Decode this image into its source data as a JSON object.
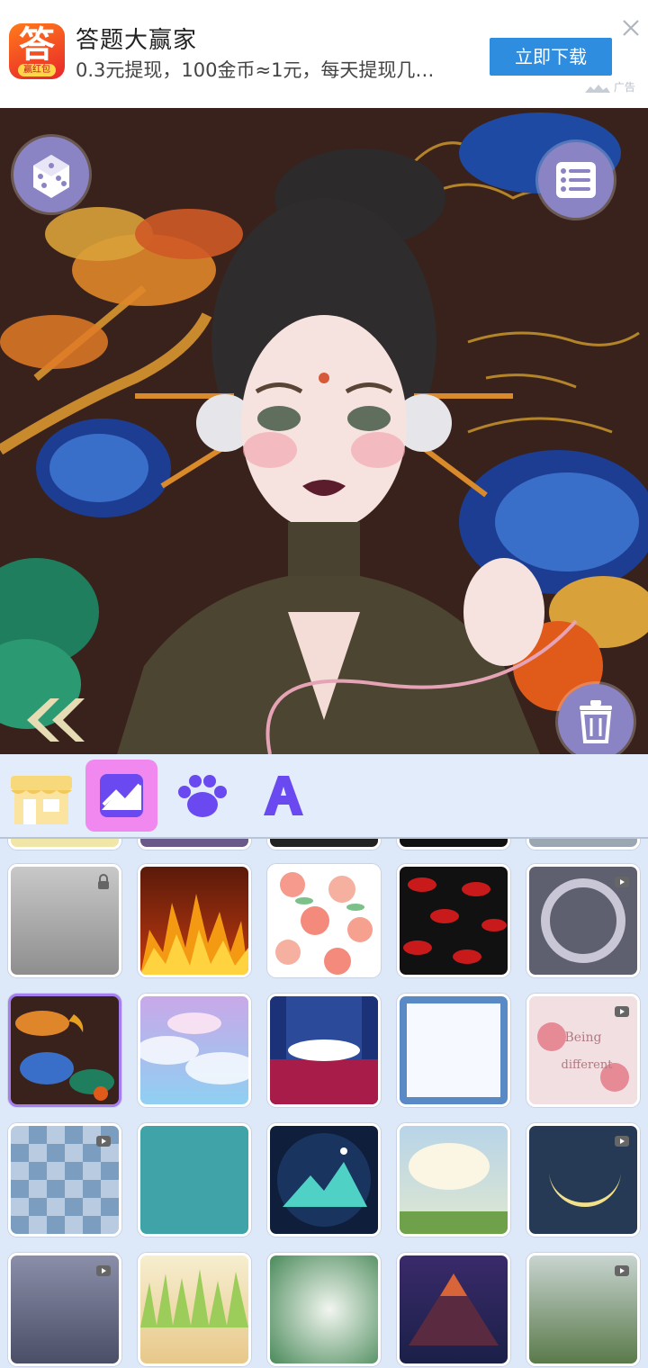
{
  "ad": {
    "logo_char": "答",
    "logo_badge": "赢红包",
    "title": "答题大赢家",
    "subtitle": "0.3元提现，100金币≈1元，每天提现几…",
    "button": "立即下载",
    "tag": "广告"
  },
  "stage": {
    "random_button_icon": "dice-icon",
    "menu_button_icon": "list-icon",
    "back_button_icon": "double-chevron-left-icon",
    "delete_button_icon": "trash-icon"
  },
  "toolbar": {
    "tabs": [
      {
        "name": "shop",
        "icon": "storefront-icon",
        "active": false
      },
      {
        "name": "background",
        "icon": "image-icon",
        "active": true
      },
      {
        "name": "pet",
        "icon": "paw-icon",
        "active": false
      },
      {
        "name": "text",
        "icon": "letter-a-icon",
        "active": false
      }
    ]
  },
  "backgrounds": [
    {
      "name": "misty-water",
      "locked": true
    },
    {
      "name": "flames",
      "locked": false
    },
    {
      "name": "peaches",
      "locked": false
    },
    {
      "name": "red-lips",
      "locked": false
    },
    {
      "name": "thorn-wreath",
      "locked": true
    },
    {
      "name": "pine-clouds-moon",
      "locked": false,
      "selected": true
    },
    {
      "name": "pastel-clouds",
      "locked": false
    },
    {
      "name": "waves-clouds",
      "locked": false
    },
    {
      "name": "paper-planes",
      "locked": false
    },
    {
      "name": "cherries-text",
      "locked": true,
      "text_lines": [
        "Being",
        "different"
      ]
    },
    {
      "name": "bow-checker",
      "locked": true
    },
    {
      "name": "teal-damask",
      "locked": false
    },
    {
      "name": "night-mountains",
      "locked": false
    },
    {
      "name": "clouds-meadow",
      "locked": false
    },
    {
      "name": "crescent-moon",
      "locked": true
    },
    {
      "name": "sun-rays-grey",
      "locked": true
    },
    {
      "name": "grass-sand",
      "locked": false
    },
    {
      "name": "forest-light",
      "locked": false
    },
    {
      "name": "lantern-mountain",
      "locked": false
    },
    {
      "name": "green-field",
      "locked": true
    }
  ],
  "colors": {
    "accent": "#f088f0",
    "selected_border": "#a77ef0",
    "circle_button": "#8a84c4",
    "ad_button": "#2e8ddf"
  }
}
